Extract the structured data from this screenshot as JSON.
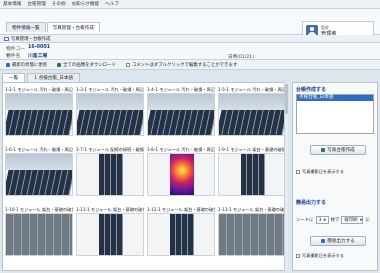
{
  "menu": [
    "基本情報",
    "台帳管理",
    "その他",
    "お知らせ機能",
    "ヘルプ"
  ],
  "top_tabs": [
    "物件情報一覧",
    "写真管理・台帳作成"
  ],
  "user": {
    "label": "管理",
    "name": "管理者"
  },
  "breadcrumb": "写真管理・台帳作成",
  "info": {
    "code_label": "物件コード",
    "code_value": "16-0001",
    "name_label": "物件名",
    "name_value": "川島工場",
    "extra": "日時(01/21)"
  },
  "toolbar": {
    "refresh": "最新の状態に更新",
    "download_all": "全ての画像をダウンロード",
    "comment_checkbox": "コメントはダブルクリックで編集することができます"
  },
  "content_tabs": [
    "一覧",
    "1 点検台帳_日本語"
  ],
  "photos": [
    {
      "label": "1-2-1 モジュール 汚れ・破損・周辺",
      "kind": "landscape"
    },
    {
      "label": "1-3-1 モジュール 汚れ・破損・周辺",
      "kind": "landscape"
    },
    {
      "label": "1-4-1 モジュール 汚れ・破損・周辺",
      "kind": "landscape"
    },
    {
      "label": "1-5-1 モジュール 汚れ・破損・周辺",
      "kind": "landscape"
    },
    {
      "label": "1-6-1 モジュール 汚れ・破損・周辺",
      "kind": "landscape"
    },
    {
      "label": "1-7-1 モジュール 配線の接続・破損",
      "kind": "portrait"
    },
    {
      "label": "1-8-1 モジュール 汚れ・破損・周辺",
      "kind": "thermal"
    },
    {
      "label": "1-9-1 モジュール 架台・基礎の破損",
      "kind": "portrait"
    },
    {
      "label": "1-10-1 モジュール 架台・基礎の破損",
      "kind": "roof"
    },
    {
      "label": "1-11-1 モジュール 架台・基礎の破損",
      "kind": "portrait"
    },
    {
      "label": "1-12-1 モジュール 架台・基礎の破損",
      "kind": "portrait"
    },
    {
      "label": "1-13-1 モジュール 架台・基礎の破損",
      "kind": "roof"
    }
  ],
  "right_panel": {
    "ledger_title": "台帳作成する",
    "ledger_selected": "点検台帳_日本語",
    "ledger_button": "写真台帳作成",
    "output_title": "簡易出力する",
    "sheet_label": "シートに",
    "sheet_count": "3",
    "sheet_unit": "枚で",
    "orientation": "縦印刷",
    "orientation_suffix": "に",
    "output_button": "簡易出力する",
    "show_date": "写真撮影日を表示する"
  }
}
